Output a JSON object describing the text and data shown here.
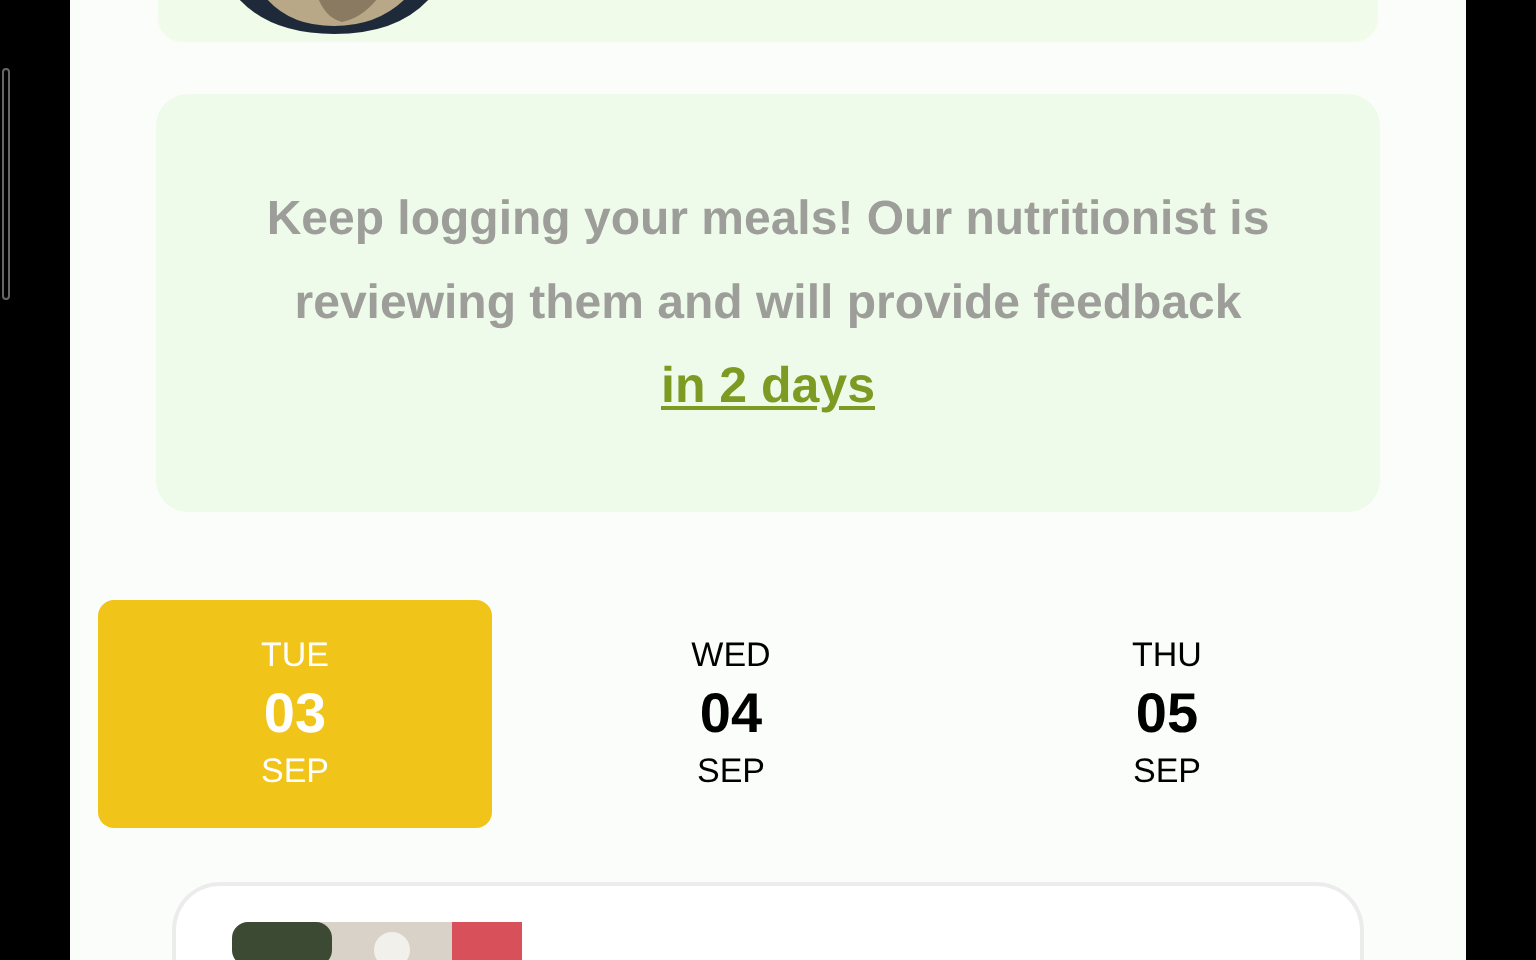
{
  "message": {
    "text": "Keep logging your meals! Our nutritionist is reviewing them and will provide feedback",
    "link": "in 2 days"
  },
  "days": [
    {
      "weekday": "TUE",
      "day": "03",
      "month": "SEP",
      "selected": true
    },
    {
      "weekday": "WED",
      "day": "04",
      "month": "SEP",
      "selected": false
    },
    {
      "weekday": "THU",
      "day": "05",
      "month": "SEP",
      "selected": false
    }
  ]
}
